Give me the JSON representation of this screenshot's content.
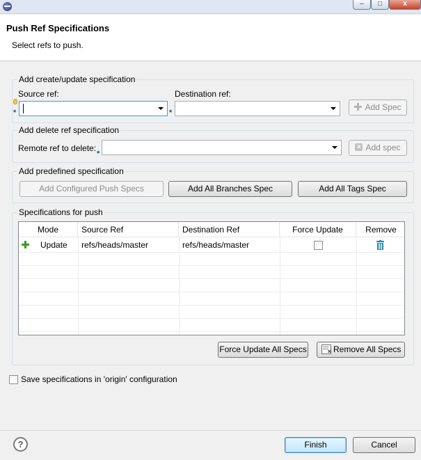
{
  "window": {
    "title_icon": "eclipse-icon",
    "controls": [
      "–",
      "□",
      "x"
    ]
  },
  "header": {
    "title": "Push Ref Specifications",
    "subtitle": "Select refs to push."
  },
  "create_group": {
    "label": "Add create/update specification",
    "source_label": "Source ref:",
    "source_value": "",
    "destination_label": "Destination ref:",
    "destination_value": "",
    "add_button": "Add Spec"
  },
  "delete_group": {
    "label": "Add delete ref specification",
    "remote_label": "Remote ref to delete:",
    "remote_value": "",
    "add_button": "Add spec"
  },
  "predefined_group": {
    "label": "Add predefined specification",
    "configured_button": "Add Configured Push Specs",
    "branches_button": "Add All Branches Spec",
    "tags_button": "Add All Tags Spec"
  },
  "specs_group": {
    "label": "Specifications for push",
    "columns": [
      "Mode",
      "Source Ref",
      "Destination Ref",
      "Force Update",
      "Remove"
    ],
    "rows": [
      {
        "mode": "Update",
        "source": "refs/heads/master",
        "destination": "refs/heads/master",
        "force_update": false
      }
    ],
    "force_all_button": "Force Update All Specs",
    "remove_all_button": "Remove All Specs"
  },
  "save_checkbox": {
    "label": "Save specifications in 'origin' configuration",
    "checked": false
  },
  "footer": {
    "help_label": "?",
    "finish_button": "Finish",
    "cancel_button": "Cancel"
  },
  "colors": {
    "background": "#f0f0f0",
    "header_bg": "#ffffff",
    "focus_border": "#3399ff",
    "required_marker": "#2a4a9e",
    "plus_green": "#3c9a1c",
    "trash_teal": "#2a8aa8"
  }
}
